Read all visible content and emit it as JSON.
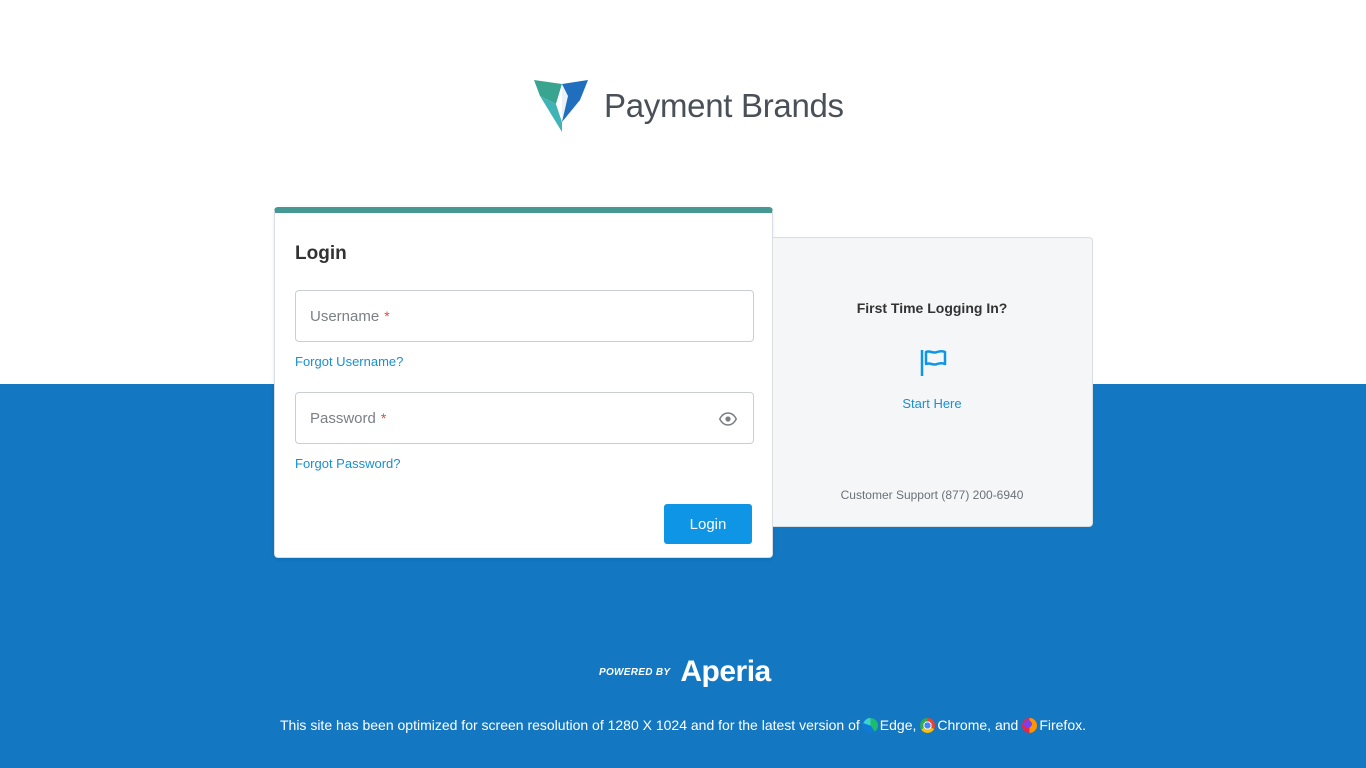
{
  "brand": {
    "name": "Payment Brands"
  },
  "login": {
    "title": "Login",
    "username_label": "Username",
    "password_label": "Password",
    "required_mark": "*",
    "forgot_username": "Forgot Username?",
    "forgot_password": "Forgot Password?",
    "submit_label": "Login"
  },
  "side_panel": {
    "title": "First Time Logging In?",
    "start_label": "Start Here",
    "support_text": "Customer Support (877) 200-6940"
  },
  "footer": {
    "powered_by": "POWERED BY",
    "powered_brand": "Aperia",
    "note_prefix": "This site has been optimized for screen resolution of 1280 X 1024 and for the latest version of",
    "browser_edge": "Edge,",
    "browser_chrome": "Chrome, and",
    "browser_firefox": "Firefox."
  },
  "colors": {
    "accent_teal": "#459893",
    "primary_blue": "#0e95e5",
    "footer_blue": "#1377c2",
    "link_blue": "#1a8fd1"
  },
  "icons": {
    "logo": "shield-logo-icon",
    "eye": "eye-icon",
    "flag": "flag-icon",
    "edge": "edge-icon",
    "chrome": "chrome-icon",
    "firefox": "firefox-icon"
  }
}
